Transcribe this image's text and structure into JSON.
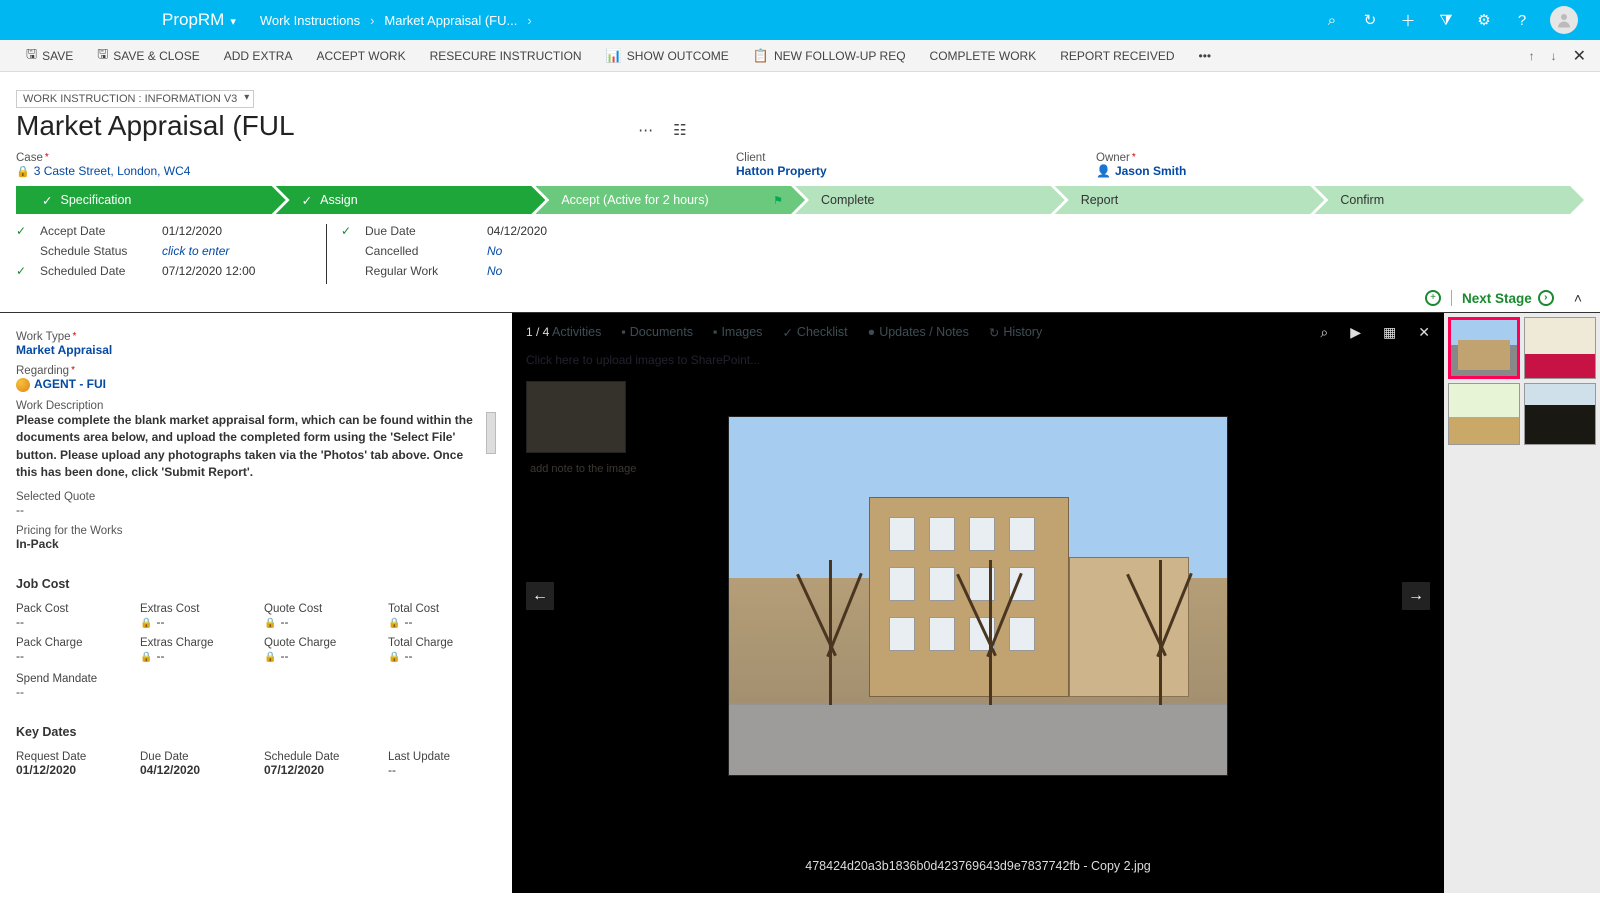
{
  "header": {
    "brand": "PropRM",
    "breadcrumbs": [
      "Work Instructions",
      "Market Appraisal (FU..."
    ]
  },
  "cmdbar": {
    "save": "SAVE",
    "save_close": "SAVE & CLOSE",
    "add_extra": "ADD EXTRA",
    "accept_work": "ACCEPT WORK",
    "resecure": "RESECURE INSTRUCTION",
    "show_outcome": "SHOW OUTCOME",
    "new_followup": "NEW FOLLOW-UP REQ",
    "complete_work": "COMPLETE WORK",
    "report_received": "REPORT RECEIVED"
  },
  "form_picker": "WORK INSTRUCTION : INFORMATION V3",
  "page_title": "Market Appraisal (FUL",
  "summary": {
    "case_label": "Case",
    "case_value": "3 Caste Street, London, WC4",
    "client_label": "Client",
    "client_value": "Hatton Property",
    "owner_label": "Owner",
    "owner_value": "Jason Smith"
  },
  "stages": {
    "spec": "Specification",
    "assign": "Assign",
    "accept": "Accept (Active for 2 hours)",
    "complete": "Complete",
    "report": "Report",
    "confirm": "Confirm"
  },
  "details": {
    "accept_date_l": "Accept Date",
    "accept_date_v": "01/12/2020",
    "schedule_status_l": "Schedule Status",
    "schedule_status_v": "click to enter",
    "scheduled_date_l": "Scheduled Date",
    "scheduled_date_v": "07/12/2020   12:00",
    "due_date_l": "Due Date",
    "due_date_v": "04/12/2020",
    "cancelled_l": "Cancelled",
    "cancelled_v": "No",
    "regular_work_l": "Regular Work",
    "regular_work_v": "No"
  },
  "next_stage": "Next Stage",
  "left": {
    "work_type_l": "Work Type",
    "work_type_v": "Market Appraisal",
    "regarding_l": "Regarding",
    "regarding_v": "AGENT - FUI",
    "work_desc_l": "Work Description",
    "work_desc_v": "Please complete the blank market appraisal form, which can be found within the documents area below, and upload the completed form using the 'Select File' button. Please upload any photographs taken via the 'Photos' tab above. Once this has been done, click 'Submit Report'.",
    "selected_quote_l": "Selected Quote",
    "selected_quote_v": "--",
    "pricing_l": "Pricing for the Works",
    "pricing_v": "In-Pack",
    "job_cost_h": "Job Cost",
    "pack_cost": "Pack Cost",
    "extras_cost": "Extras Cost",
    "quote_cost": "Quote Cost",
    "total_cost": "Total Cost",
    "pack_charge": "Pack Charge",
    "extras_charge": "Extras Charge",
    "quote_charge": "Quote Charge",
    "total_charge": "Total Charge",
    "spend_mandate": "Spend Mandate",
    "key_dates_h": "Key Dates",
    "request_date_l": "Request Date",
    "request_date_v": "01/12/2020",
    "kd_due_date_l": "Due Date",
    "kd_due_date_v": "04/12/2020",
    "schedule_date_l": "Schedule Date",
    "schedule_date_v": "07/12/2020",
    "last_update_l": "Last Update",
    "last_update_v": "--"
  },
  "viewer": {
    "counter": "1 / 4",
    "dim_tabs": {
      "activities": "Activities",
      "documents": "Documents",
      "images": "Images",
      "checklist": "Checklist",
      "updates": "Updates / Notes",
      "history": "History"
    },
    "upload_hint": "Click here to upload images to SharePoint...",
    "add_note": "add note to the image",
    "caption": "478424d20a3b1836b0d423769643d9e7837742fb - Copy 2.jpg"
  }
}
